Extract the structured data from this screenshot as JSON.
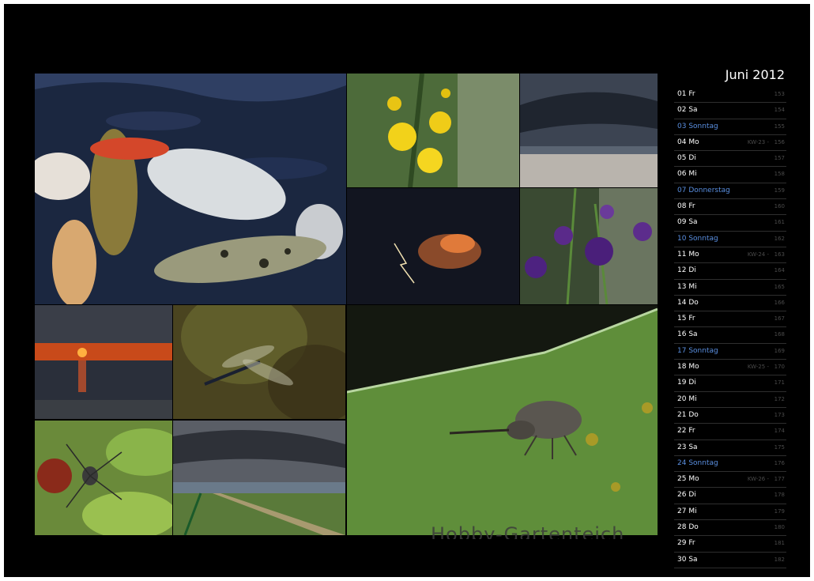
{
  "calendar": {
    "title": "Juni 2012",
    "sunday_color": "#5a8fe0",
    "days": [
      {
        "label": "01 Fr",
        "kw": "",
        "doy": "153",
        "sunday": false
      },
      {
        "label": "02 Sa",
        "kw": "",
        "doy": "154",
        "sunday": false
      },
      {
        "label": "03 Sonntag",
        "kw": "",
        "doy": "155",
        "sunday": true
      },
      {
        "label": "04 Mo",
        "kw": "KW-23 -",
        "doy": "156",
        "sunday": false
      },
      {
        "label": "05 Di",
        "kw": "",
        "doy": "157",
        "sunday": false
      },
      {
        "label": "06 Mi",
        "kw": "",
        "doy": "158",
        "sunday": false
      },
      {
        "label": "07 Donnerstag",
        "kw": "",
        "doy": "159",
        "sunday": true
      },
      {
        "label": "08 Fr",
        "kw": "",
        "doy": "160",
        "sunday": false
      },
      {
        "label": "09 Sa",
        "kw": "",
        "doy": "161",
        "sunday": false
      },
      {
        "label": "10 Sonntag",
        "kw": "",
        "doy": "162",
        "sunday": true
      },
      {
        "label": "11 Mo",
        "kw": "KW-24 -",
        "doy": "163",
        "sunday": false
      },
      {
        "label": "12 Di",
        "kw": "",
        "doy": "164",
        "sunday": false
      },
      {
        "label": "13 Mi",
        "kw": "",
        "doy": "165",
        "sunday": false
      },
      {
        "label": "14 Do",
        "kw": "",
        "doy": "166",
        "sunday": false
      },
      {
        "label": "15 Fr",
        "kw": "",
        "doy": "167",
        "sunday": false
      },
      {
        "label": "16 Sa",
        "kw": "",
        "doy": "168",
        "sunday": false
      },
      {
        "label": "17 Sonntag",
        "kw": "",
        "doy": "169",
        "sunday": true
      },
      {
        "label": "18 Mo",
        "kw": "KW-25 -",
        "doy": "170",
        "sunday": false
      },
      {
        "label": "19 Di",
        "kw": "",
        "doy": "171",
        "sunday": false
      },
      {
        "label": "20 Mi",
        "kw": "",
        "doy": "172",
        "sunday": false
      },
      {
        "label": "21 Do",
        "kw": "",
        "doy": "173",
        "sunday": false
      },
      {
        "label": "22 Fr",
        "kw": "",
        "doy": "174",
        "sunday": false
      },
      {
        "label": "23 Sa",
        "kw": "",
        "doy": "175",
        "sunday": false
      },
      {
        "label": "24 Sonntag",
        "kw": "",
        "doy": "176",
        "sunday": true
      },
      {
        "label": "25 Mo",
        "kw": "KW-26 -",
        "doy": "177",
        "sunday": false
      },
      {
        "label": "26 Di",
        "kw": "",
        "doy": "178",
        "sunday": false
      },
      {
        "label": "27 Mi",
        "kw": "",
        "doy": "179",
        "sunday": false
      },
      {
        "label": "28 Do",
        "kw": "",
        "doy": "180",
        "sunday": false
      },
      {
        "label": "29 Fr",
        "kw": "",
        "doy": "181",
        "sunday": false
      },
      {
        "label": "30 Sa",
        "kw": "",
        "doy": "182",
        "sunday": false
      }
    ]
  },
  "watermark": "Hobby-Gartenteich"
}
